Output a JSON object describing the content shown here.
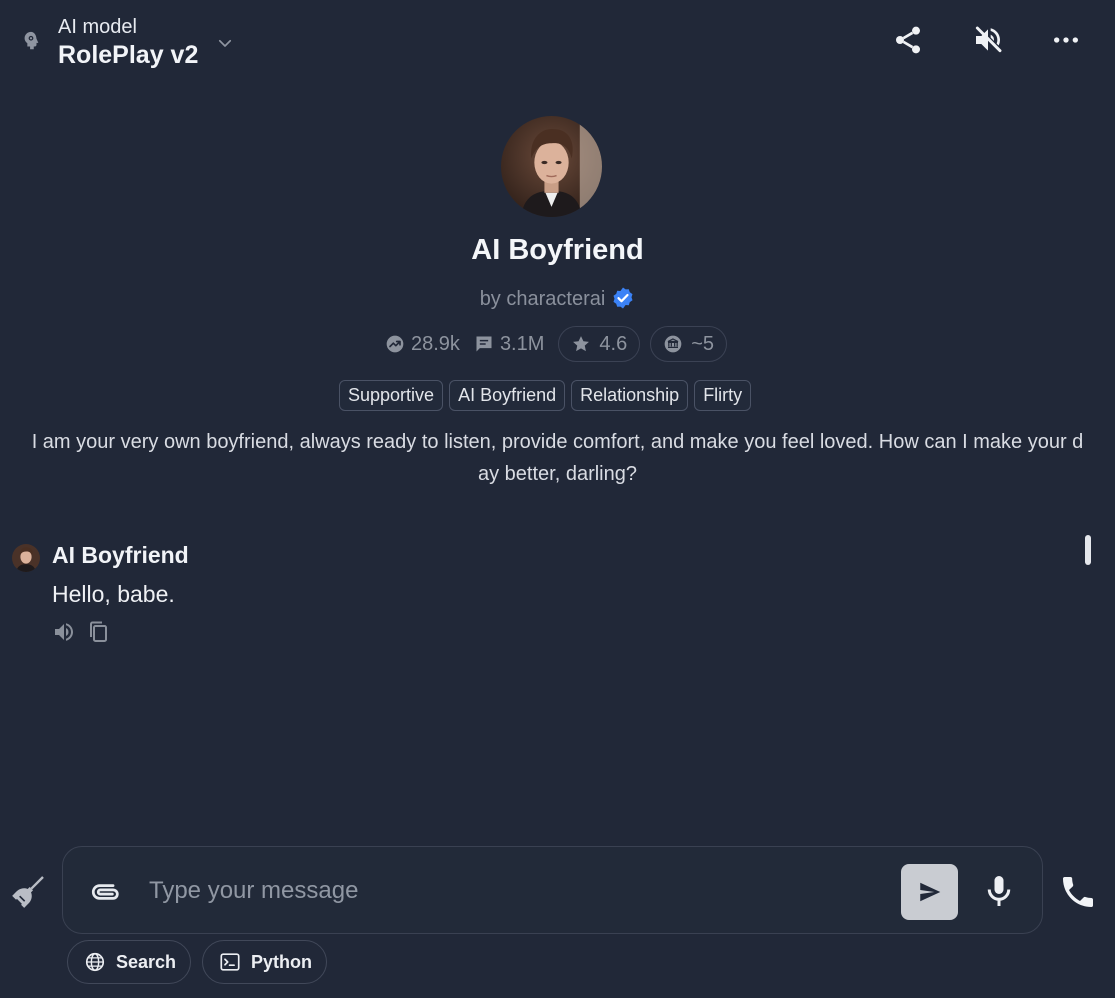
{
  "header": {
    "model_label": "AI model",
    "model_name": "RolePlay v2",
    "icons": [
      "brain-icon",
      "chevron-down-icon",
      "share-icon",
      "mute-icon",
      "more-icon"
    ]
  },
  "character": {
    "name": "AI Boyfriend",
    "author": "by characterai",
    "stats": {
      "trending": "28.9k",
      "chats": "3.1M",
      "rating": "4.6",
      "tokens": "~5"
    },
    "tags": [
      "Supportive",
      "AI Boyfriend",
      "Relationship",
      "Flirty"
    ],
    "greeting_line1": "I am your very own boyfriend, always ready to listen, provide comfort, and make you feel loved. How can I make your d",
    "greeting_line2": "ay better, darling?"
  },
  "messages": [
    {
      "author": "AI Boyfriend",
      "text": "Hello, babe."
    }
  ],
  "composer": {
    "placeholder": "Type your message",
    "value": ""
  },
  "tools": {
    "search_label": "Search",
    "python_label": "Python"
  },
  "colors": {
    "background": "#212838",
    "verified": "#3b82f6",
    "send_button": "#c9ccd2"
  }
}
